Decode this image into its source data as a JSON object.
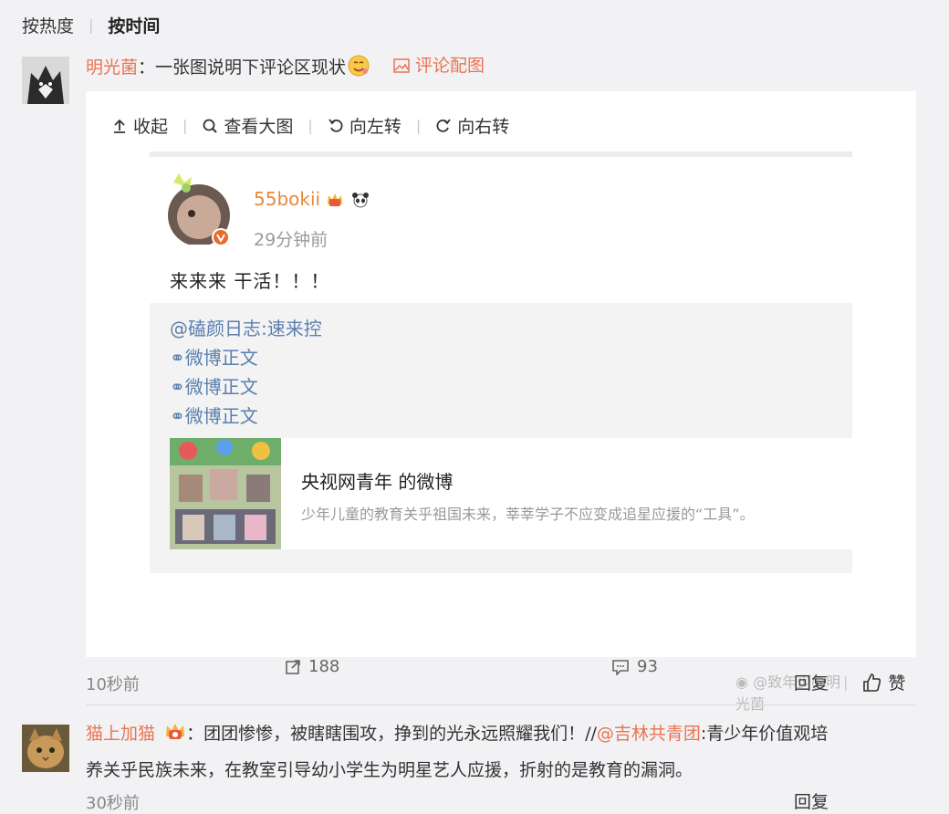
{
  "sort": {
    "hot_label": "按热度",
    "time_label": "按时间"
  },
  "comment1": {
    "author": "明光菌",
    "colon": "：",
    "text": "一张图说明下评论区现状",
    "image_link": "评论配图",
    "toolbar": {
      "collapse": "收起",
      "view_large": "查看大图",
      "rotate_left": "向左转",
      "rotate_right": "向右转"
    },
    "screenshot": {
      "username": "55bokii",
      "time": "29分钟前",
      "text": "来来来 干活！！！",
      "quote_lines": [
        "@磕颜日志:速来控",
        "微博正文",
        "微博正文",
        "微博正文"
      ],
      "card_title": "央视网青年 的微博",
      "card_desc": "少年儿童的教育关乎祖国未来，莘莘学子不应变成追星应援的“工具”。",
      "reposts": "188",
      "comments": "93",
      "watermark": "@致年少@明光菌"
    },
    "time": "10秒前",
    "reply": "回复",
    "like": "赞"
  },
  "comment2": {
    "author": "猫上加猫",
    "colon": "：",
    "text_a": "团团惨惨，被瞎瞎围攻，挣到的光永远照耀我们！//",
    "mention": "@吉林共青团",
    "text_b": ":青少年价值观培",
    "text_c": "养关乎民族未来，在教室引导幼小学生为明星艺人应援，折射的是教育的漏洞。",
    "time": "30秒前",
    "reply": "回复"
  },
  "colors": {
    "accent": "#eb7350",
    "username_gold": "#e8893a",
    "link_blue": "#5a7fae"
  }
}
